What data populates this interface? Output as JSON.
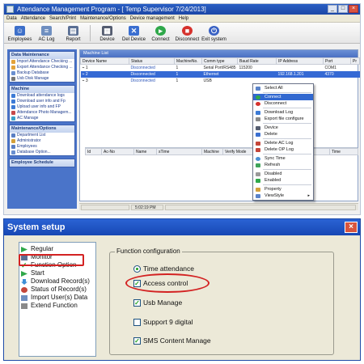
{
  "app": {
    "title": "Attendance Management Program - [ Temp Supervisor 7/24/2013]",
    "window_buttons": [
      "_",
      "□",
      "×"
    ]
  },
  "menubar": [
    "Data",
    "Attendance",
    "Search/Print",
    "Maintenance/Options",
    "Device management",
    "Help"
  ],
  "toolbar": [
    {
      "label": "Employees",
      "icon": "employees-icon",
      "color": "#3d6fc9"
    },
    {
      "label": "AC Log",
      "icon": "ac-log-icon",
      "color": "#6f8fc0"
    },
    {
      "label": "Report",
      "icon": "report-icon",
      "color": "#5a6f94"
    },
    {
      "label": "Device",
      "icon": "device-icon",
      "color": "#555d70"
    },
    {
      "label": "Del Device",
      "icon": "delete-device-icon",
      "color": "#3b6fd0"
    },
    {
      "label": "Connect",
      "icon": "connect-icon",
      "color": "#2fa84a"
    },
    {
      "label": "Disconnect",
      "icon": "disconnect-icon",
      "color": "#d6322d"
    },
    {
      "label": "Exit system",
      "icon": "exit-icon",
      "color": "#3a62c4"
    }
  ],
  "sidebar": {
    "data_maintenance": {
      "header": "Data Maintenance",
      "items": [
        "Import Attendance Checking ...",
        "Export Attendance Checking ...",
        "Backup Database",
        "Usb Disk Manage"
      ]
    },
    "machine": {
      "header": "Machine",
      "items": [
        "Download attendance logs",
        "Download user info and Fp",
        "Upload user info and FP",
        "Attendance Photo Managem...",
        "AC Manage"
      ]
    },
    "maintenance_options": {
      "header": "Maintenance/Options",
      "items": [
        "Department List",
        "Administrator",
        "Employees",
        "Database Option..."
      ]
    },
    "employee_schedule": {
      "header": "Employee Schedule"
    }
  },
  "machine_list": {
    "header": "Machine List",
    "columns": [
      "Device Name",
      "Status",
      "MachineNo.",
      "Comm type",
      "Baud Rate",
      "IP Address",
      "Port",
      "Pr"
    ],
    "rows": [
      {
        "name": "1",
        "status": "Disconnected",
        "machine_no": "1",
        "comm": "Serial Port/RS485",
        "baud": "115200",
        "ip": "",
        "port": "COM1"
      },
      {
        "name": "2",
        "status": "Disconnected",
        "machine_no": "1",
        "comm": "Ethernet",
        "baud": "",
        "ip": "192.168.1.201",
        "port": "4370"
      },
      {
        "name": "3",
        "status": "Disconnected",
        "machine_no": "1",
        "comm": "USB",
        "baud": "",
        "ip": "",
        "port": ""
      }
    ]
  },
  "log_grid": {
    "columns": [
      "Id",
      "Ac-No",
      "Name",
      "sTime",
      "Machine",
      "Verify Mode",
      "Time"
    ]
  },
  "statusbar": {
    "time": "5:02:19 PM"
  },
  "context_menu": [
    {
      "label": "Select All",
      "icon": "select-all-icon"
    },
    {
      "sep": true
    },
    {
      "label": "Connect",
      "icon": "connect-icon",
      "highlight": true
    },
    {
      "label": "Disconnect",
      "icon": "disconnect-icon"
    },
    {
      "sep": true
    },
    {
      "label": "Download Log",
      "icon": "download-log-icon"
    },
    {
      "label": "Export file configure",
      "icon": "export-config-icon"
    },
    {
      "sep": true
    },
    {
      "label": "Device",
      "icon": "device-icon"
    },
    {
      "label": "Delete",
      "icon": "delete-icon"
    },
    {
      "sep": true
    },
    {
      "label": "Delete AC Log",
      "icon": "delete-ac-log-icon"
    },
    {
      "label": "Delete OP Log",
      "icon": "delete-op-log-icon"
    },
    {
      "sep": true
    },
    {
      "label": "Sync Time",
      "icon": "sync-time-icon"
    },
    {
      "label": "Refresh",
      "icon": "refresh-icon"
    },
    {
      "sep": true
    },
    {
      "label": "Disabled",
      "icon": "disabled-icon"
    },
    {
      "label": "Enabled",
      "icon": "enabled-icon"
    },
    {
      "sep": true
    },
    {
      "label": "Property",
      "icon": "property-icon"
    },
    {
      "label": "ViewStyle",
      "icon": "view-style-icon",
      "submenu": true
    }
  ],
  "dialog": {
    "title": "System setup",
    "close": "×",
    "tree": [
      "Regular",
      "Monitor",
      "Function Option",
      "Start",
      "Download Record(s)",
      "Status of Record(s)",
      "Import User(s) Data",
      "Extend Function"
    ],
    "group_label": "Function configuration",
    "radio": "Time attendance",
    "checkboxes": [
      {
        "label": "Access control",
        "checked": true
      },
      {
        "label": "Usb Manage",
        "checked": true
      },
      {
        "label": "Support 9 digital",
        "checked": false
      },
      {
        "label": "SMS Content Manage",
        "checked": true
      }
    ],
    "check_mark": "✓"
  }
}
